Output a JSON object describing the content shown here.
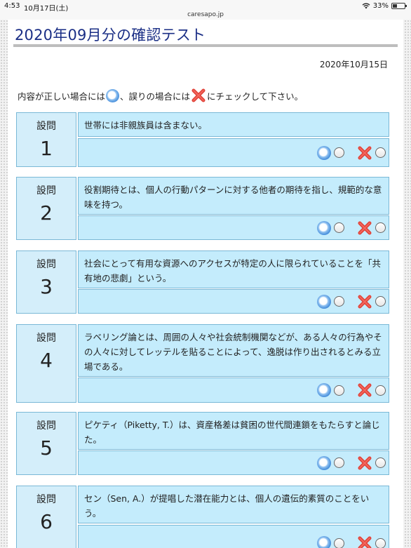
{
  "status_bar": {
    "time": "4:53",
    "date": "10月17日(土)",
    "url": "caresapo.jp",
    "battery": "33%"
  },
  "page": {
    "title": "2020年09月分の確認テスト",
    "date": "2020年10月15日",
    "instruction": {
      "part1": "内容が正しい場合には",
      "part2": "、誤りの場合には",
      "part3": "にチェックして下さい。"
    }
  },
  "question_label": "設問",
  "questions": [
    {
      "number": "1",
      "text": "世帯には非親族員は含まない。"
    },
    {
      "number": "2",
      "text": "役割期待とは、個人の行動パターンに対する他者の期待を指し、規範的な意味を持つ。"
    },
    {
      "number": "3",
      "text": "社会にとって有用な資源へのアクセスが特定の人に限られていることを「共有地の悲劇」という。"
    },
    {
      "number": "4",
      "text": "ラベリング論とは、周囲の人々や社会統制機関などが、ある人々の行為やその人々に対してレッテルを貼ることによって、逸脱は作り出されるとみる立場である。"
    },
    {
      "number": "5",
      "text": "ピケティ（Piketty, T.）は、資産格差は貧困の世代間連鎖をもたらすと論じた。"
    },
    {
      "number": "6",
      "text": "セン（Sen, A.）が提唱した潜在能力とは、個人の遺伝的素質のことをいう。"
    }
  ],
  "icons": {
    "correct": "maru-icon",
    "wrong": "batsu-icon",
    "accent_color": "#1b2f86",
    "box_color": "#c4ecfc"
  }
}
